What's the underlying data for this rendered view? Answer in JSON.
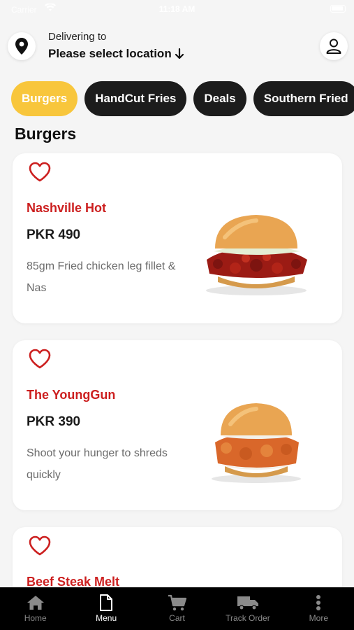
{
  "status_bar": {
    "carrier": "Carrier",
    "time": "11:18 AM"
  },
  "header": {
    "delivering_label": "Delivering to",
    "location_value": "Please select location"
  },
  "categories": [
    {
      "label": "Burgers",
      "active": true
    },
    {
      "label": "HandCut Fries",
      "active": false
    },
    {
      "label": "Deals",
      "active": false
    },
    {
      "label": "Southern Fried",
      "active": false
    }
  ],
  "section_title": "Burgers",
  "products": [
    {
      "name": "Nashville Hot",
      "price": "PKR 490",
      "description": "85gm Fried chicken leg fillet & Nas"
    },
    {
      "name": "The YoungGun",
      "price": "PKR 390",
      "description": "Shoot your hunger to shreds quickly"
    },
    {
      "name": "Beef Steak Melt"
    }
  ],
  "bottom_nav": [
    {
      "label": "Home",
      "icon": "home-icon"
    },
    {
      "label": "Menu",
      "icon": "menu-document-icon"
    },
    {
      "label": "Cart",
      "icon": "cart-icon"
    },
    {
      "label": "Track Order",
      "icon": "truck-icon"
    },
    {
      "label": "More",
      "icon": "more-vertical-icon"
    }
  ],
  "colors": {
    "accent_yellow": "#f8c63c",
    "product_name_red": "#cc1f1f",
    "chip_dark": "#1c1c1c",
    "nav_background": "#000000"
  }
}
